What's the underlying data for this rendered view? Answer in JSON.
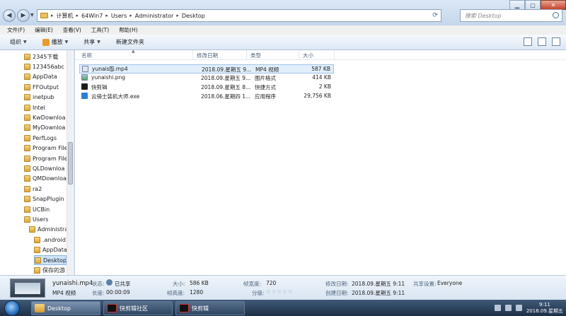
{
  "window": {
    "minimize": "▁",
    "maximize": "▢",
    "close": "✕"
  },
  "address": {
    "crumbs": [
      "计算机",
      "64Win7",
      "Users",
      "Administrator",
      "Desktop"
    ],
    "search_placeholder": "搜索 Desktop"
  },
  "menu": [
    "文件(F)",
    "编辑(E)",
    "查看(V)",
    "工具(T)",
    "帮助(H)"
  ],
  "toolbar": {
    "organize": "组织",
    "play": "播放",
    "share": "共享",
    "new_folder": "新建文件夹"
  },
  "nav_items": [
    {
      "label": "2345下载",
      "indent": 0,
      "selected": false
    },
    {
      "label": "123456abc (",
      "indent": 0,
      "selected": false
    },
    {
      "label": "AppData",
      "indent": 0,
      "selected": false
    },
    {
      "label": "FFOutput",
      "indent": 0,
      "selected": false
    },
    {
      "label": "inetpub",
      "indent": 0,
      "selected": false
    },
    {
      "label": "Intel",
      "indent": 0,
      "selected": false
    },
    {
      "label": "KwDownloa",
      "indent": 0,
      "selected": false
    },
    {
      "label": "MyDownloa",
      "indent": 0,
      "selected": false
    },
    {
      "label": "PerfLogs",
      "indent": 0,
      "selected": false
    },
    {
      "label": "Program File",
      "indent": 0,
      "selected": false
    },
    {
      "label": "Program File",
      "indent": 0,
      "selected": false
    },
    {
      "label": "QLDownloa",
      "indent": 0,
      "selected": false
    },
    {
      "label": "QMDownloa",
      "indent": 0,
      "selected": false
    },
    {
      "label": "ra2",
      "indent": 0,
      "selected": false
    },
    {
      "label": "SnapPlugin",
      "indent": 0,
      "selected": false
    },
    {
      "label": "UCBin",
      "indent": 0,
      "selected": false
    },
    {
      "label": "Users",
      "indent": 0,
      "selected": false
    },
    {
      "label": "Administra",
      "indent": 1,
      "selected": false
    },
    {
      "label": ".android",
      "indent": 2,
      "selected": false
    },
    {
      "label": "AppData",
      "indent": 2,
      "selected": false
    },
    {
      "label": "Desktop",
      "indent": 2,
      "selected": true
    },
    {
      "label": "保存的游",
      "indent": 2,
      "selected": false
    }
  ],
  "columns": {
    "name": "名称",
    "date": "修改日期",
    "type": "类型",
    "size": "大小"
  },
  "files": [
    {
      "name": "yunaishi.mp4",
      "date": "2018.09.星期五 9...",
      "type": "MP4 视频",
      "size": "587 KB",
      "icon": "video",
      "selected": true
    },
    {
      "name": "yunaishi.png",
      "date": "2018.09.星期五 9...",
      "type": "图片格式",
      "size": "414 KB",
      "icon": "image",
      "selected": false
    },
    {
      "name": "快剪辑",
      "date": "2018.09.星期五 8...",
      "type": "快捷方式",
      "size": "2 KB",
      "icon": "shortcut",
      "selected": false
    },
    {
      "name": "云骑士装机大师.exe",
      "date": "2018.06.星期四 1...",
      "type": "应用程序",
      "size": "29,756 KB",
      "icon": "exe",
      "selected": false
    }
  ],
  "details": {
    "filename": "yunaishi.mp4",
    "filetype": "MP4 视频",
    "status_label": "状态:",
    "status_value": "已共享",
    "length_label": "长度:",
    "length_value": "00:00:09",
    "size_label": "大小:",
    "size_value": "586 KB",
    "frame_height_label": "帧高度:",
    "frame_height_value": "1280",
    "frame_width_label": "帧宽度:",
    "frame_width_value": "720",
    "rating_label": "分级:",
    "rating_stars": "☆☆☆☆☆",
    "modified_label": "修改日期:",
    "modified_value": "2018.09.星期五 9:11",
    "created_label": "创建日期:",
    "created_value": "2018.09.星期五 9:11",
    "shared_with_label": "共享设置:",
    "shared_with_value": "Everyone"
  },
  "taskbar": {
    "buttons": [
      {
        "label": "Desktop",
        "icon": "folder-icon",
        "active": true
      },
      {
        "label": "快剪辑社区",
        "icon": "app-icon",
        "active": false
      },
      {
        "label": "快剪辑",
        "icon": "app-icon",
        "active": false
      }
    ],
    "time": "9:11",
    "date": "2018.09.星期五"
  }
}
